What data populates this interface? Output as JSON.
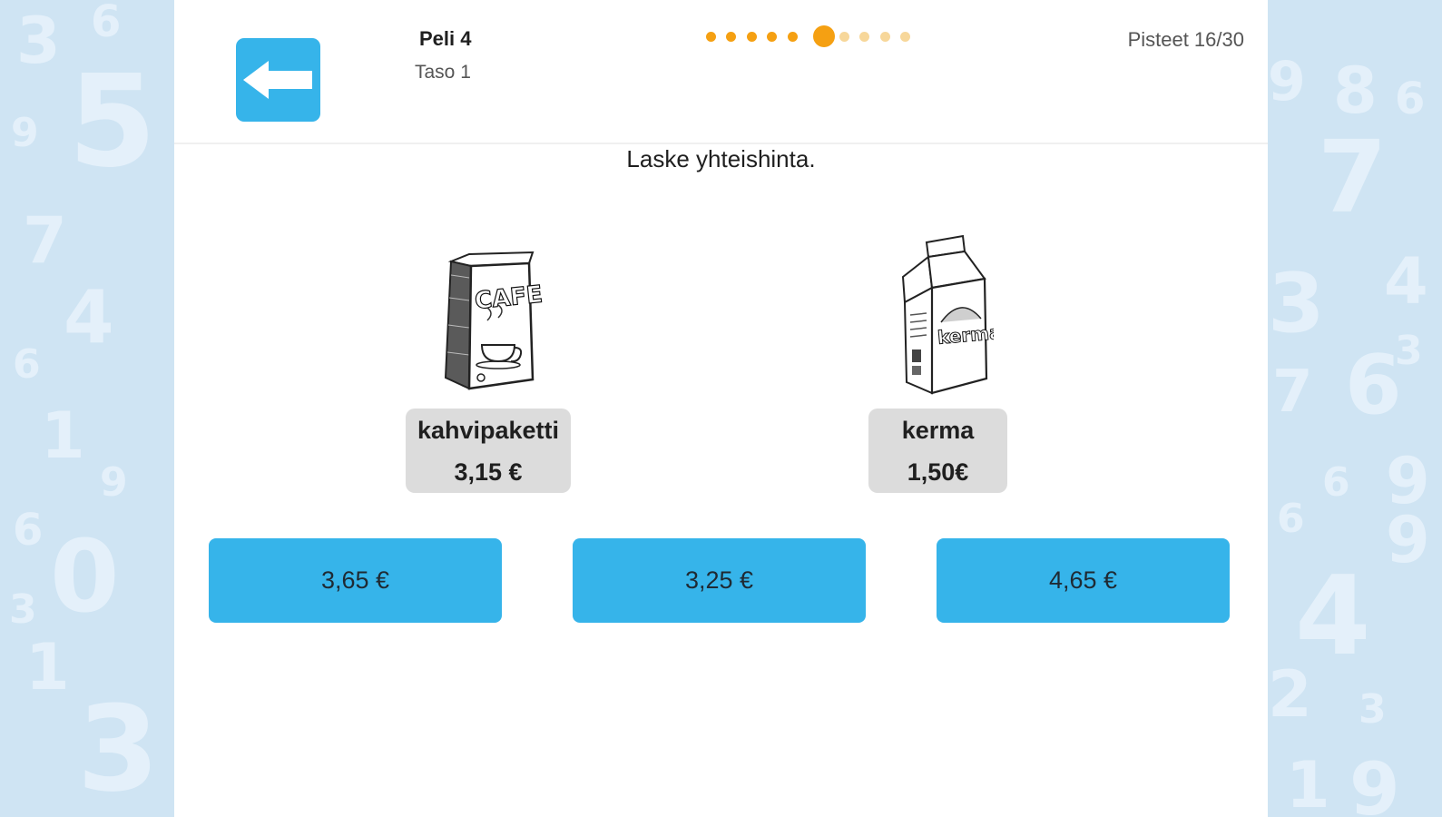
{
  "header": {
    "back_icon": "arrow-left-icon",
    "game_title": "Peli 4",
    "level": "Taso 1",
    "score": "Pisteet 16/30",
    "progress": {
      "total": 10,
      "current": 6,
      "completed": 5
    }
  },
  "instruction": "Laske yhteishinta.",
  "products": [
    {
      "name": "kahvipaketti",
      "price": "3,15 €",
      "image_text": "CAFE",
      "icon": "coffee-package-icon"
    },
    {
      "name": "kerma",
      "price": "1,50€",
      "image_text": "kerma",
      "icon": "cream-carton-icon"
    }
  ],
  "answers": [
    "3,65 €",
    "3,25 €",
    "4,65 €"
  ],
  "colors": {
    "accent_blue": "#36b4ea",
    "progress_orange": "#f5a012",
    "progress_light": "#f7d79a",
    "background": "#cfe4f3"
  }
}
